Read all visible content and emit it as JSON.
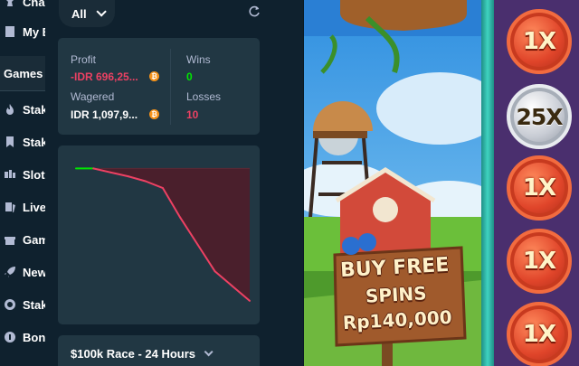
{
  "sidebar": {
    "items": [
      {
        "label": "Chal",
        "icon": "challenges-icon"
      },
      {
        "label": "My B",
        "icon": "my-bets-icon"
      },
      {
        "label": "Stak",
        "icon": "stake-originals-icon"
      },
      {
        "label": "Stak",
        "icon": "stake-exclusives-icon"
      },
      {
        "label": "Slots",
        "icon": "slots-icon"
      },
      {
        "label": "Live",
        "icon": "live-casino-icon"
      },
      {
        "label": "Gam",
        "icon": "game-shows-icon"
      },
      {
        "label": "New",
        "icon": "new-releases-icon"
      },
      {
        "label": "Stak",
        "icon": "stake-poker-icon"
      },
      {
        "label": "Bonu",
        "icon": "bonus-buy-icon"
      }
    ],
    "section_label": "Games"
  },
  "panel": {
    "filter_label": "All",
    "stats": {
      "profit_label": "Profit",
      "profit_value": "-IDR 696,25...",
      "wagered_label": "Wagered",
      "wagered_value": "IDR 1,097,9...",
      "wins_label": "Wins",
      "wins_value": "0",
      "losses_label": "Losses",
      "losses_value": "10",
      "coin_symbol": "₿"
    },
    "race_label": "$100k Race - 24 Hours"
  },
  "chart_data": {
    "type": "area",
    "x": [
      0,
      1,
      2,
      3,
      4,
      5,
      6,
      7,
      8,
      9,
      10
    ],
    "values": [
      0,
      0,
      -8,
      -16,
      -26,
      -40,
      -100,
      -155,
      -210,
      -240,
      -270
    ],
    "ylim": [
      -285,
      10
    ],
    "colors": {
      "positive": "#00e701",
      "negative": "#ed4163",
      "fill": "#4a1f2c"
    }
  },
  "game": {
    "multipliers": [
      "1X",
      "25X",
      "1X",
      "1X",
      "1X"
    ],
    "sign_lines": [
      "BUY FREE",
      "SPINS",
      "Rp140,000"
    ],
    "colors": {
      "reel_bg": "#4a2f6e",
      "frame": "#3fd3c0"
    }
  },
  "colors": {
    "sidebar_bg": "#0f212e",
    "card_bg": "#213743",
    "label": "#b1bad3",
    "profit_negative": "#ed4163",
    "wins": "#00e701",
    "losses": "#ed4163",
    "coin": "#f7931a"
  }
}
